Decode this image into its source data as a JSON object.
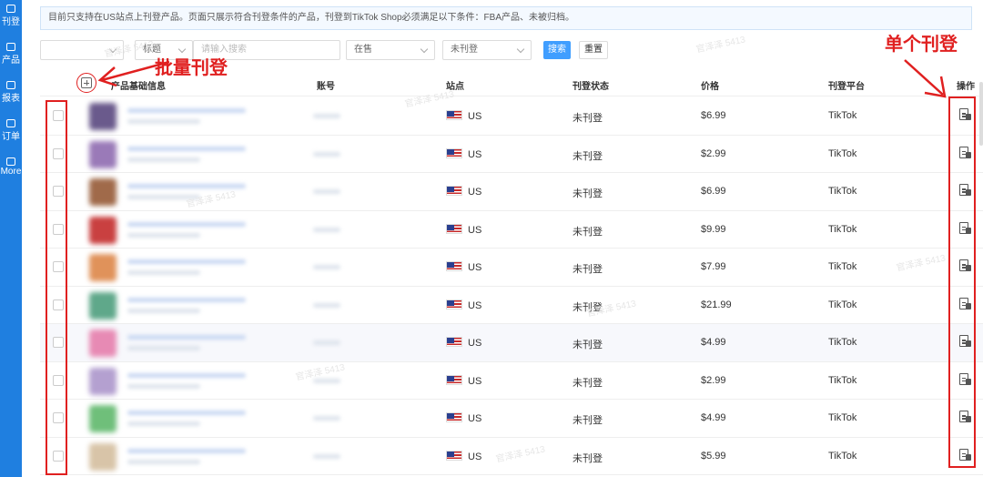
{
  "sidebar": {
    "items": [
      {
        "label": "刊登"
      },
      {
        "label": "产品"
      },
      {
        "label": "报表"
      },
      {
        "label": "订单"
      },
      {
        "label": "More"
      }
    ]
  },
  "notice": "目前只支持在US站点上刊登产品。页面只展示符合刊登条件的产品，刊登到TikTok Shop必须满足以下条件：FBA产品、未被归档。",
  "filters": {
    "store_select": "",
    "field_select": "标题",
    "search_placeholder": "请输入搜索",
    "status_select": "在售",
    "listing_select": "未刊登",
    "search_button": "搜索",
    "reset_button": "重置"
  },
  "table": {
    "headers": {
      "product": "产品基础信息",
      "account": "账号",
      "site": "站点",
      "status": "刊登状态",
      "price": "价格",
      "platform": "刊登平台",
      "action": "操作"
    },
    "rows": [
      {
        "site": "US",
        "status": "未刊登",
        "price": "$6.99",
        "platform": "TikTok"
      },
      {
        "site": "US",
        "status": "未刊登",
        "price": "$2.99",
        "platform": "TikTok"
      },
      {
        "site": "US",
        "status": "未刊登",
        "price": "$6.99",
        "platform": "TikTok"
      },
      {
        "site": "US",
        "status": "未刊登",
        "price": "$9.99",
        "platform": "TikTok"
      },
      {
        "site": "US",
        "status": "未刊登",
        "price": "$7.99",
        "platform": "TikTok"
      },
      {
        "site": "US",
        "status": "未刊登",
        "price": "$21.99",
        "platform": "TikTok"
      },
      {
        "site": "US",
        "status": "未刊登",
        "price": "$4.99",
        "platform": "TikTok"
      },
      {
        "site": "US",
        "status": "未刊登",
        "price": "$2.99",
        "platform": "TikTok"
      },
      {
        "site": "US",
        "status": "未刊登",
        "price": "$4.99",
        "platform": "TikTok"
      },
      {
        "site": "US",
        "status": "未刊登",
        "price": "$5.99",
        "platform": "TikTok"
      }
    ]
  },
  "annotations": {
    "bulk": "批量刊登",
    "single": "单个刊登"
  },
  "watermark": "官泽泽 5413",
  "colors": {
    "sidebar": "#1f7fe0",
    "primary": "#409eff",
    "annotation": "#e02020"
  }
}
